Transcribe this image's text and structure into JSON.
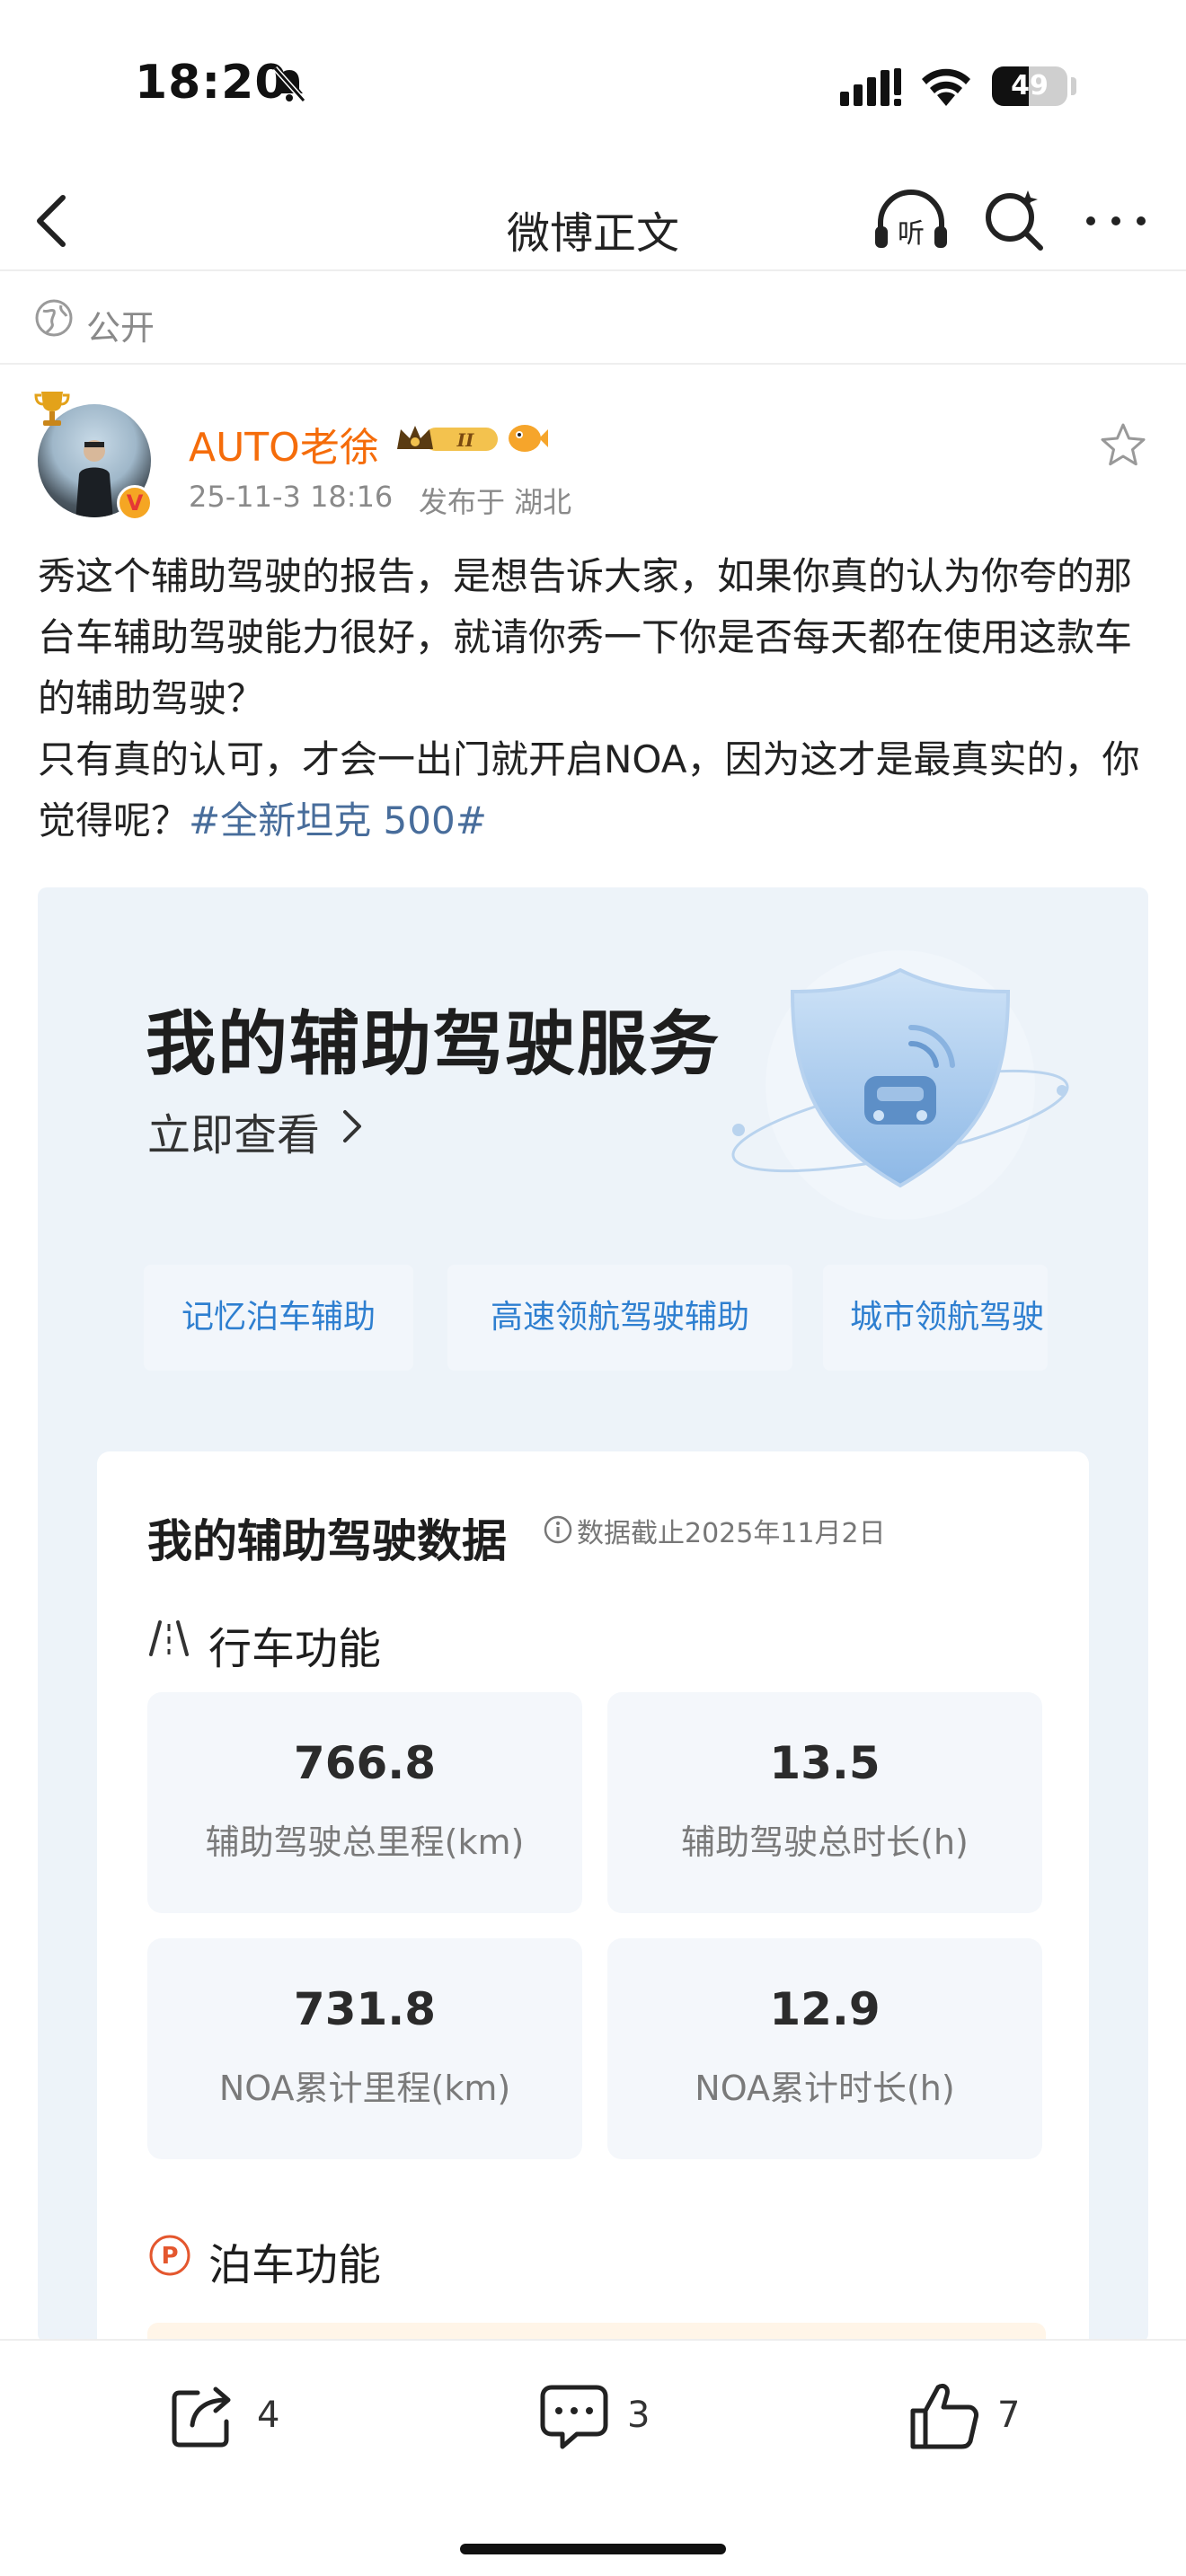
{
  "status_bar": {
    "time": "18:20",
    "battery_text": "49",
    "battery_level_percent": 49
  },
  "nav": {
    "title": "微博正文",
    "icons": [
      "back-icon",
      "listen-icon",
      "search-icon",
      "more-icon"
    ]
  },
  "visibility": {
    "label": "公开",
    "icon": "globe-icon"
  },
  "author": {
    "name": "AUTO老徐",
    "time": "25-11-3 18:16",
    "location": "发布于 湖北",
    "level_badge": "II",
    "verified_badge": "V"
  },
  "post": {
    "text": "秀这个辅助驾驶的报告，是想告诉大家，如果你真的认为你夸的那台车辅助驾驶能力很好，就请你秀一下你是否每天都在使用这款车的辅助驾驶？\n只有真的认可，才会一出门就开启NOA，因为这才是最真实的，你觉得呢？",
    "hashtag": "#全新坦克 500#"
  },
  "image": {
    "service_title": "我的辅助驾驶服务",
    "view_now": "立即查看",
    "chips": [
      "记忆泊车辅助",
      "高速领航驾驶辅助",
      "城市领航驾驶"
    ],
    "data_title": "我的辅助驾驶数据",
    "data_date": "数据截止2025年11月2日",
    "driving_label": "行车功能",
    "stats": [
      {
        "value": "766.8",
        "label": "辅助驾驶总里程(km)"
      },
      {
        "value": "13.5",
        "label": "辅助驾驶总时长(h)"
      },
      {
        "value": "731.8",
        "label": "NOA累计里程(km)"
      },
      {
        "value": "12.9",
        "label": "NOA累计时长(h)"
      }
    ],
    "parking_label": "泊车功能",
    "accent_color": "#2e7fd0"
  },
  "actions": {
    "share_count": "4",
    "comment_count": "3",
    "like_count": "7"
  },
  "colors": {
    "author_name": "#f56c0a",
    "hashtag": "#486d9b",
    "meta_text": "#8a8a8a"
  }
}
